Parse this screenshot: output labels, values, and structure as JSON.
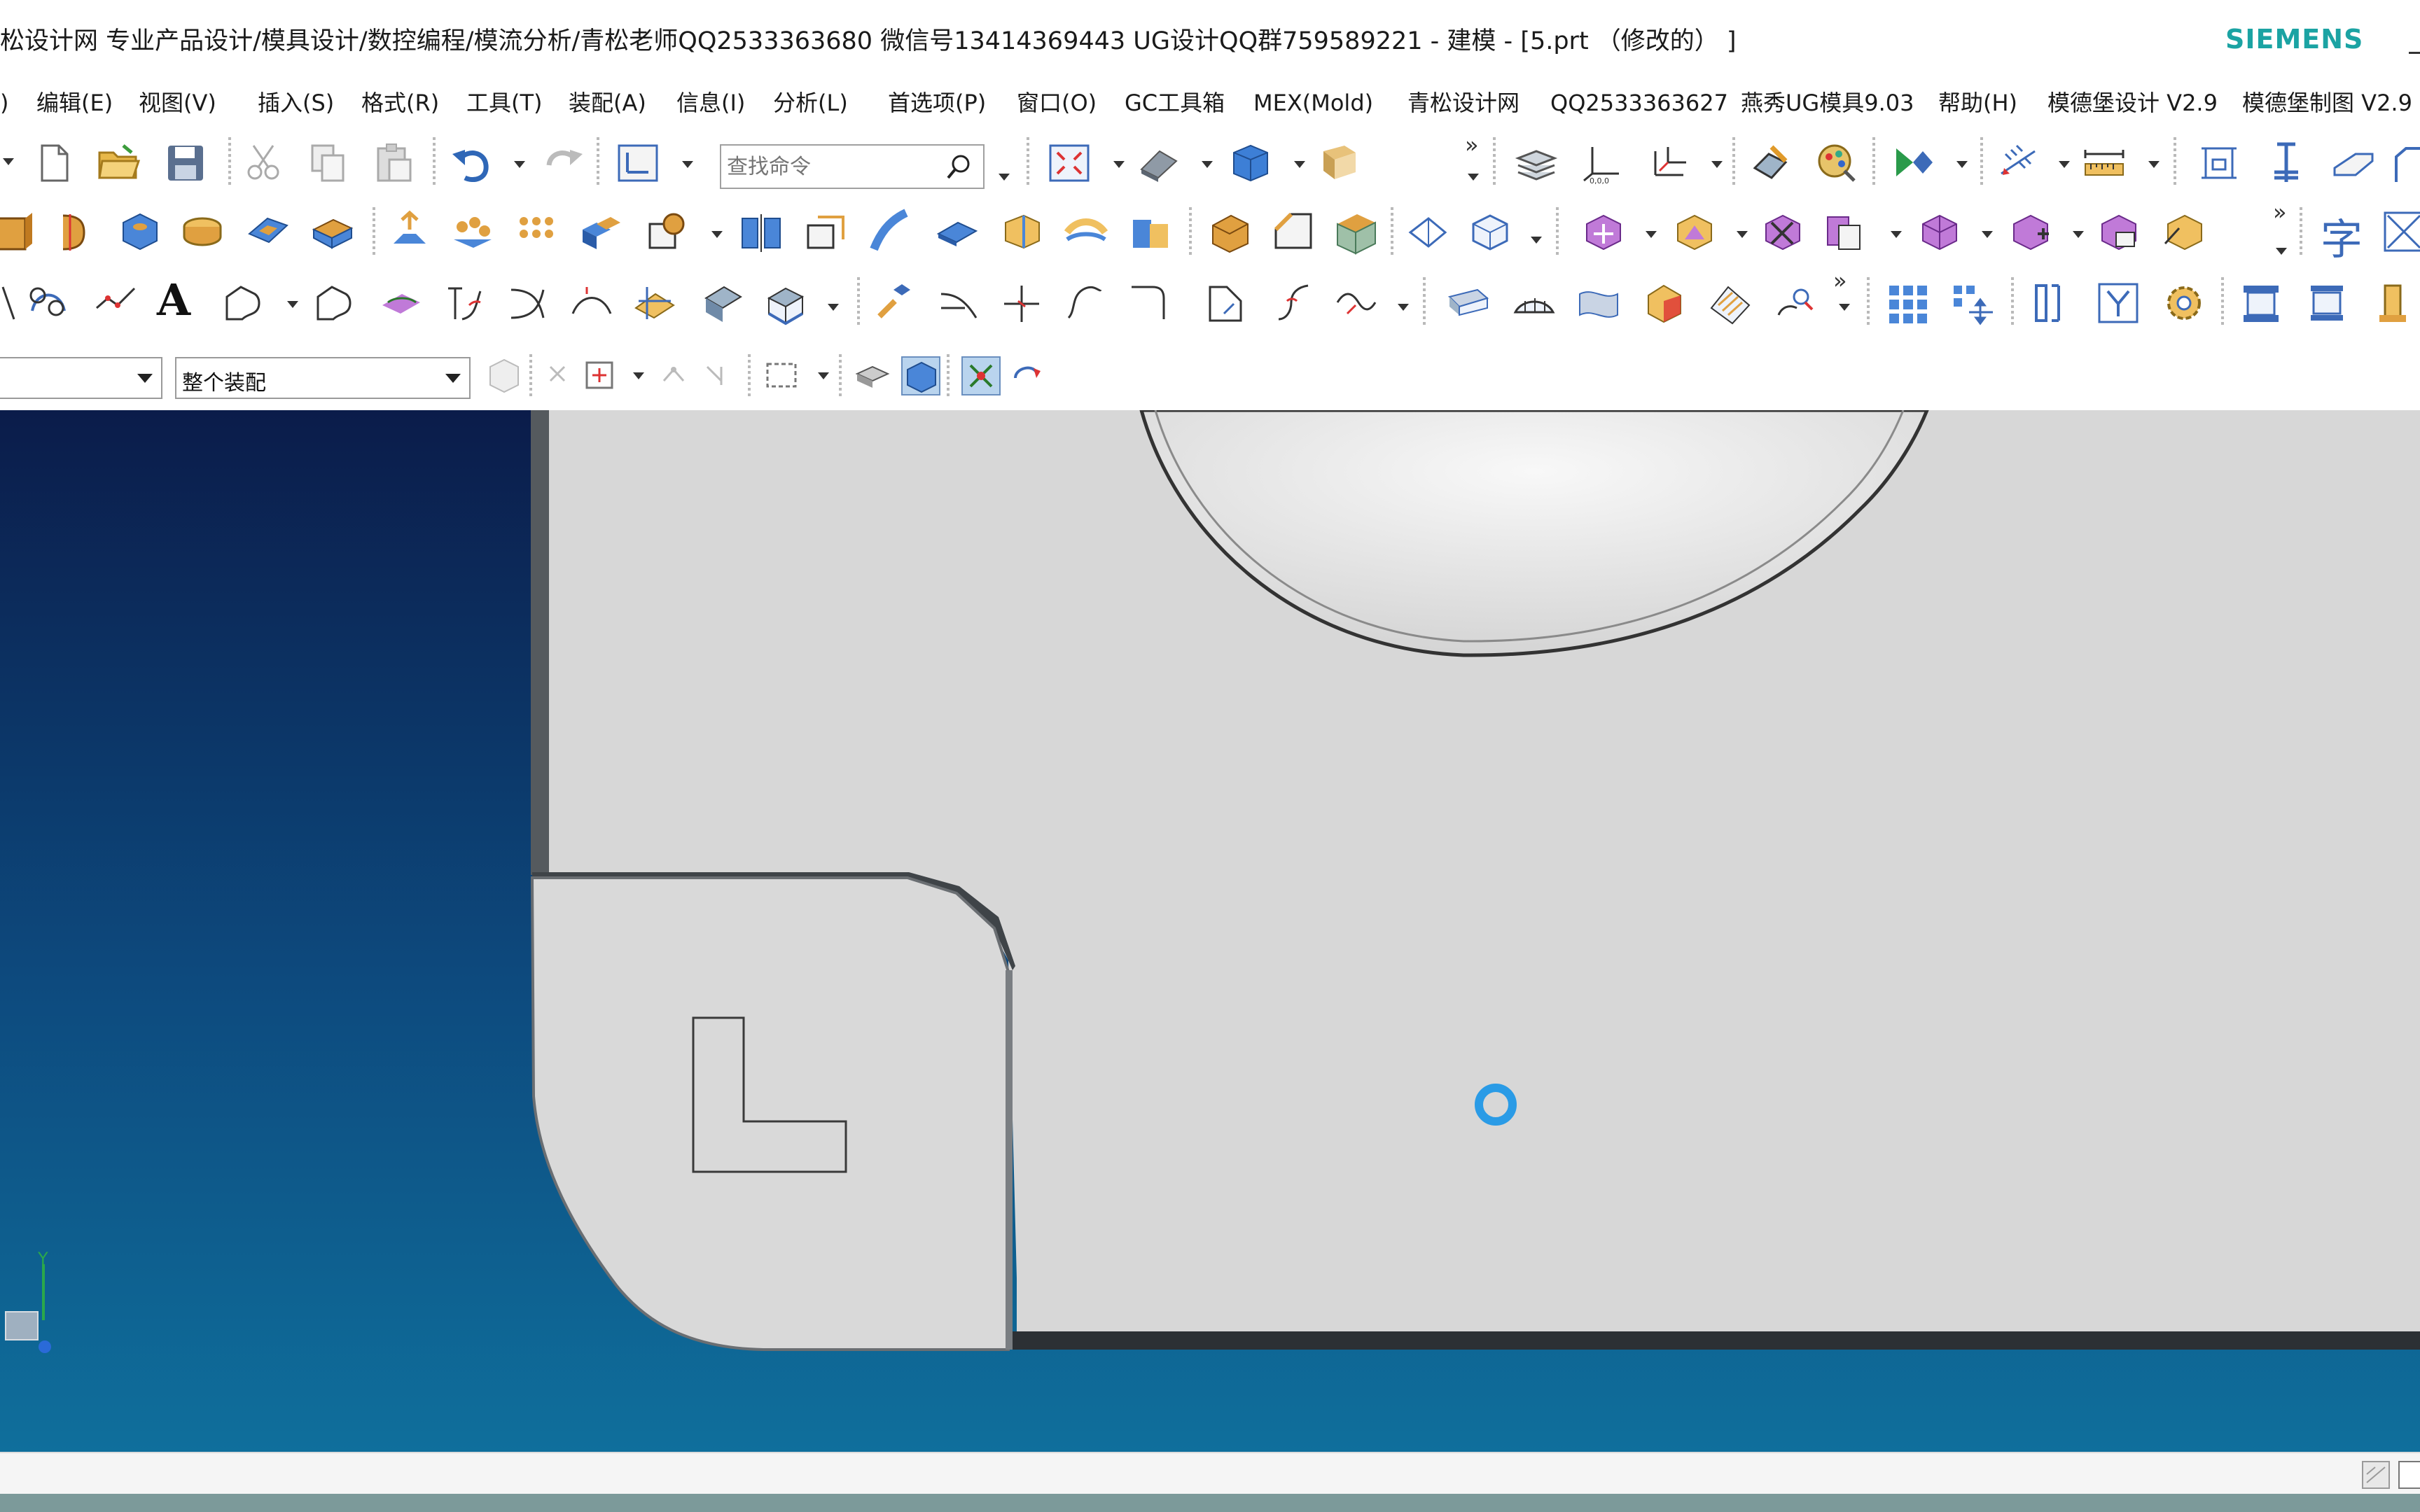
{
  "window": {
    "title": "松设计网 专业产品设计/模具设计/数控编程/模流分析/青松老师QQ2533363680 微信号13414369443 UG设计QQ群759589221 - 建模 - [5.prt （修改的） ]",
    "brand": "SIEMENS"
  },
  "menu": {
    "items": [
      {
        "label": ")"
      },
      {
        "label": "编辑(E)"
      },
      {
        "label": "视图(V)"
      },
      {
        "label": "插入(S)"
      },
      {
        "label": "格式(R)"
      },
      {
        "label": "工具(T)"
      },
      {
        "label": "装配(A)"
      },
      {
        "label": "信息(I)"
      },
      {
        "label": "分析(L)"
      },
      {
        "label": "首选项(P)"
      },
      {
        "label": "窗口(O)"
      },
      {
        "label": "GC工具箱"
      },
      {
        "label": "MEX(Mold)"
      },
      {
        "label": "青松设计网"
      },
      {
        "label": "QQ2533363627"
      },
      {
        "label": "燕秀UG模具9.03"
      },
      {
        "label": "帮助(H)"
      },
      {
        "label": "模德堡设计 V2.9"
      },
      {
        "label": "模德堡制图 V2.9"
      }
    ]
  },
  "toolbar": {
    "search_placeholder": "查找命令",
    "text_tool_label": "A",
    "char_tool_label": "字"
  },
  "selection_bar": {
    "filter_value": "",
    "scope_value": "整个装配"
  },
  "viewport": {
    "background_top": "#0b1c4a",
    "background_bottom": "#0f6f9c",
    "part_color": "#d7d7d7",
    "axis_label": "Y"
  },
  "colors": {
    "brand": "#1ba3a3",
    "cursor": "#2a9be6"
  }
}
